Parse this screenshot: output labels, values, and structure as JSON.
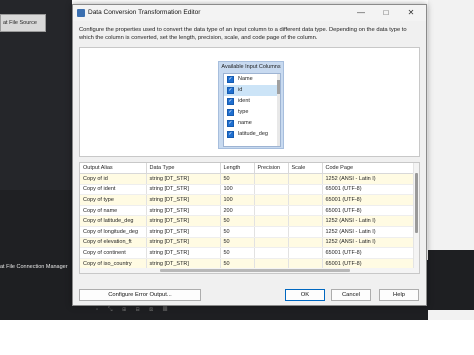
{
  "background": {
    "file_source_label": "at File Source",
    "connection_manager_label": "at File Connection Manager"
  },
  "dialog": {
    "title": "Data Conversion Transformation Editor",
    "minimize_glyph": "—",
    "maximize_glyph": "□",
    "close_glyph": "✕",
    "description": "Configure the properties used to convert the data type of an input column to a different data type. Depending on the data type to which the column is converted, set the length, precision, scale, and code page of the column."
  },
  "available_columns": {
    "title": "Available Input Columns",
    "items": [
      {
        "label": "Name",
        "checked": true,
        "selected": false
      },
      {
        "label": "id",
        "checked": true,
        "selected": true
      },
      {
        "label": "ident",
        "checked": true,
        "selected": false
      },
      {
        "label": "type",
        "checked": true,
        "selected": false
      },
      {
        "label": "name",
        "checked": true,
        "selected": false
      },
      {
        "label": "latitude_deg",
        "checked": true,
        "selected": false
      }
    ]
  },
  "grid": {
    "headers": [
      "Output Alias",
      "Data Type",
      "Length",
      "Precision",
      "Scale",
      "Code Page"
    ],
    "rows": [
      [
        "Copy of id",
        "string [DT_STR]",
        "50",
        "",
        "",
        "1252  (ANSI - Latin I)"
      ],
      [
        "Copy of ident",
        "string [DT_STR]",
        "100",
        "",
        "",
        "65001 (UTF-8)"
      ],
      [
        "Copy of type",
        "string [DT_STR]",
        "100",
        "",
        "",
        "65001 (UTF-8)"
      ],
      [
        "Copy of name",
        "string [DT_STR]",
        "200",
        "",
        "",
        "65001 (UTF-8)"
      ],
      [
        "Copy of latitude_deg",
        "string [DT_STR]",
        "50",
        "",
        "",
        "1252  (ANSI - Latin I)"
      ],
      [
        "Copy of longitude_deg",
        "string [DT_STR]",
        "50",
        "",
        "",
        "1252  (ANSI - Latin I)"
      ],
      [
        "Copy of elevation_ft",
        "string [DT_STR]",
        "50",
        "",
        "",
        "1252  (ANSI - Latin I)"
      ],
      [
        "Copy of continent",
        "string [DT_STR]",
        "50",
        "",
        "",
        "65001 (UTF-8)"
      ],
      [
        "Copy of iso_country",
        "string [DT_STR]",
        "50",
        "",
        "",
        "65001 (UTF-8)"
      ]
    ]
  },
  "buttons": {
    "configure_error_output": "Configure Error Output...",
    "ok": "OK",
    "cancel": "Cancel",
    "help": "Help"
  }
}
